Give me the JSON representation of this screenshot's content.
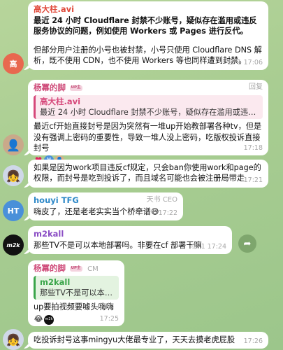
{
  "messages": [
    {
      "id": "m1",
      "sender": "高大柱.avi",
      "avatar_text": "高",
      "bold_text": "最近 24 小时 Cloudflare 封禁不少账号，疑似存在滥用或违反服务协议的问题，例如使用 Workers 或 Pages 进行反代。",
      "text": "但部分用户注册的小号也被封禁，小号只使用 Cloudflare DNS 解析，既不使用 CDN，也不使用 Workers 等也同样遭到封禁。",
      "views": "1",
      "time": "17:06"
    },
    {
      "id": "m2",
      "sender": "杨冪的脚",
      "tag": "UP主",
      "role": "回复",
      "quote_name": "高大柱.avi",
      "quote_text": "最近 24 小时 Cloudflare 封禁不少账号，疑似存在滥用或违反服务...",
      "text": "最近cf开始直接封号是因为突然有一堆up开始教部署各种tv，但是没有强调上密码的重要性，导致一堆人没上密码，吃版权投诉直接封号",
      "reaction_1": "♥",
      "reaction_2": "M",
      "time": "17:18"
    },
    {
      "id": "m3",
      "text": "如果是因为work项目违反cf规定，只会ban你使用work和page的权限，而封号是吃到投诉了，而且域名可能也会被注册局带走",
      "time": "17:21"
    },
    {
      "id": "m4",
      "sender": "houyi TFG",
      "role": "天书 CEO",
      "avatar_text": "HT",
      "text": "嗨皮了，还是老老实实当个桥牵谱😅",
      "time": "17:22"
    },
    {
      "id": "m5",
      "sender": "m2kall",
      "avatar_text": "m2k",
      "text": "那些TV不是可以本地部署吗。非要在cf 部署干嘛",
      "views": "1",
      "time": "17:24"
    },
    {
      "id": "m6",
      "sender": "杨冪的脚",
      "tag": "UP主",
      "role": "CM",
      "quote_name": "m2kall",
      "quote_text": "那些TV不是可以本地部...",
      "text": "up要拍视频要噱头嗨嗨",
      "reaction_1": "😂",
      "reaction_2": "m2k",
      "time": "17:25"
    },
    {
      "id": "m7",
      "text": "吃投诉封号这事mingyu大佬最专业了，天天去摸老虎屁股",
      "time": "17:26"
    }
  ],
  "colors": {
    "red_avatar": "#e8684f",
    "blue_avatar": "#4a90d9",
    "quote_accent": "#d6487a"
  }
}
